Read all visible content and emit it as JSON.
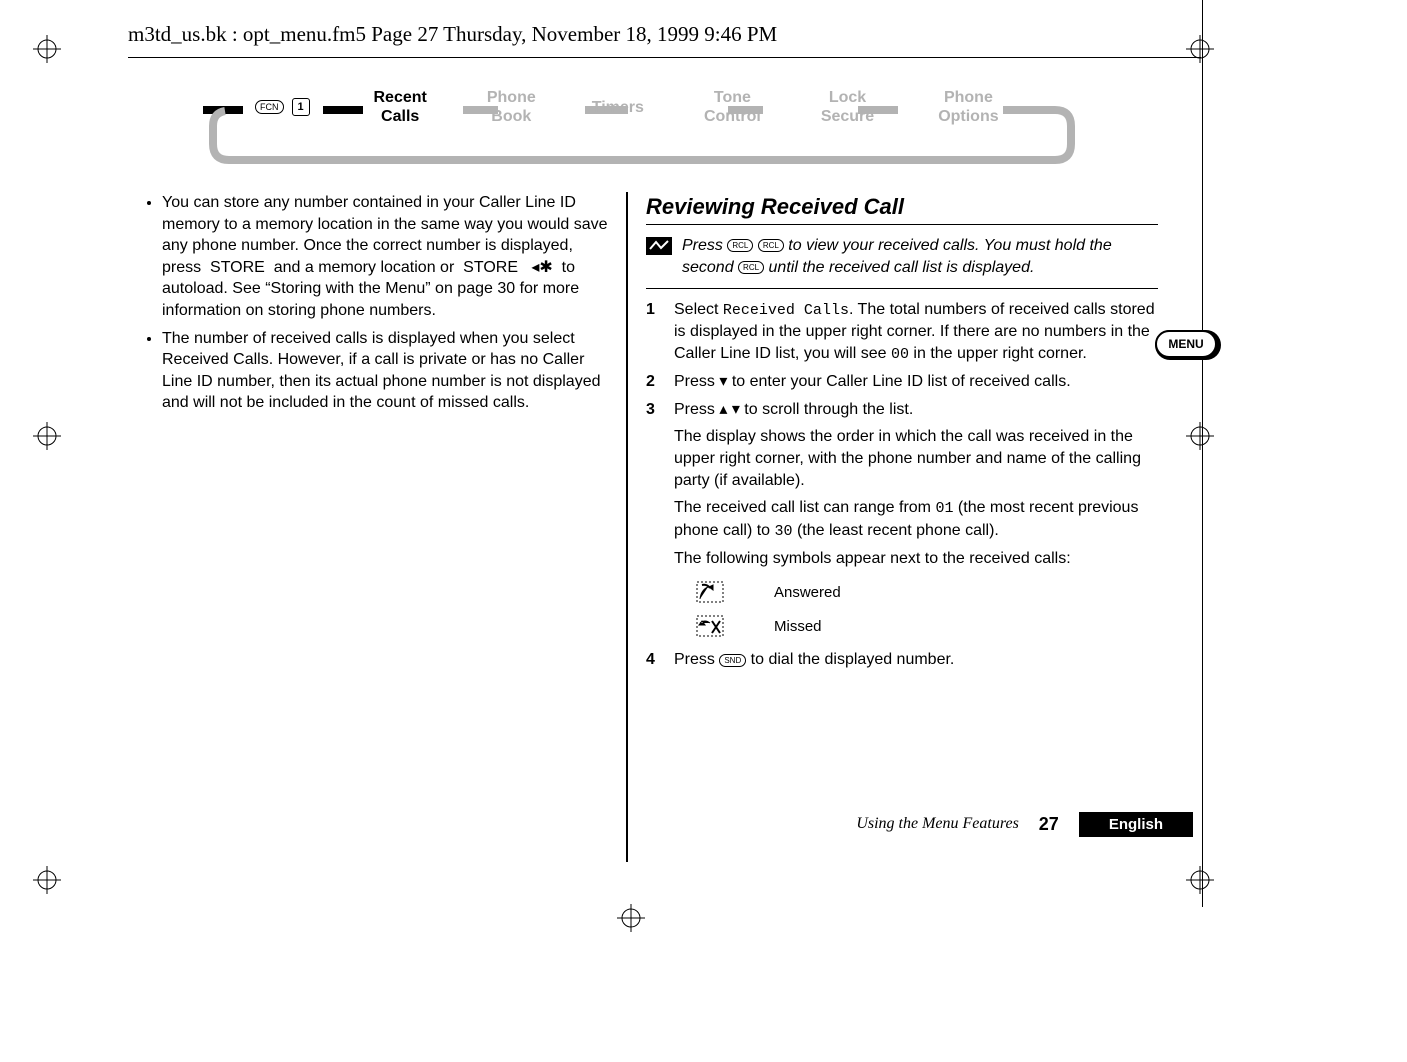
{
  "header": {
    "doc_path": "m3td_us.bk : opt_menu.fm5  Page 27  Thursday, November 18, 1999  9:46 PM"
  },
  "nav": {
    "items": [
      {
        "label_line1": "Recent",
        "label_line2": "Calls",
        "active": true
      },
      {
        "label_line1": "Phone",
        "label_line2": "Book",
        "active": false
      },
      {
        "label_line1": "Timers",
        "label_line2": "",
        "active": false
      },
      {
        "label_line1": "Tone",
        "label_line2": "Control",
        "active": false
      },
      {
        "label_line1": "Lock",
        "label_line2": "Secure",
        "active": false
      },
      {
        "label_line1": "Phone",
        "label_line2": "Options",
        "active": false
      }
    ],
    "fcn_label": "FCN",
    "one_label": "1"
  },
  "left_column": {
    "bullets": [
      "You can store any number contained in your Caller Line ID memory to a memory location in the same way you would save any phone number. Once the correct number is displayed, press  STORE  and a memory location or  STORE   ◂✱  to autoload. See “Storing with the Menu” on page 30 for more information on storing phone numbers.",
      "The number of received calls is displayed when you select Received Calls.  However, if a call is private or has no Caller Line ID number, then its actual phone number is not displayed and will not be included in the count of missed calls."
    ]
  },
  "right_column": {
    "section_title": "Reviewing Received Call",
    "tip": {
      "line1_prefix": "Press ",
      "btn1": "RCL",
      "btn2": "RCL",
      "line1_suffix": " to view your received calls. You must hold the second ",
      "btn3": "RCL",
      "line1_end": " until the received call list is displayed."
    },
    "steps": [
      {
        "text_prefix": "Select ",
        "mono": "Received Calls",
        "text_mid": ". The total numbers of received calls stored is displayed in the upper right corner. If there are no numbers in the Caller Line ID list, you will see ",
        "mono2": "00",
        "text_end": " in the upper right corner."
      },
      {
        "plain": "Press ▾ to enter your Caller Line ID list of received calls."
      },
      {
        "plain": "Press ▴ ▾ to scroll through the list."
      }
    ],
    "paragraphs": [
      "The display shows the order in which the call was received in the upper right corner, with the phone number and name of the calling party (if available).",
      "The received call list can range from 01  (the most recent previous phone call) to 30 (the least recent phone call).",
      "The following symbols appear next to the received calls:"
    ],
    "mono_snippets": {
      "p2a": "01",
      "p2b": "30"
    },
    "symbols": [
      {
        "label": "Answered"
      },
      {
        "label": "Missed"
      }
    ],
    "step4_prefix": "Press ",
    "step4_btn": "SND",
    "step4_suffix": " to dial the displayed number."
  },
  "footer": {
    "section": "Using the Menu Features",
    "page": "27",
    "language": "English"
  },
  "side_tab": {
    "label": "MENU"
  }
}
